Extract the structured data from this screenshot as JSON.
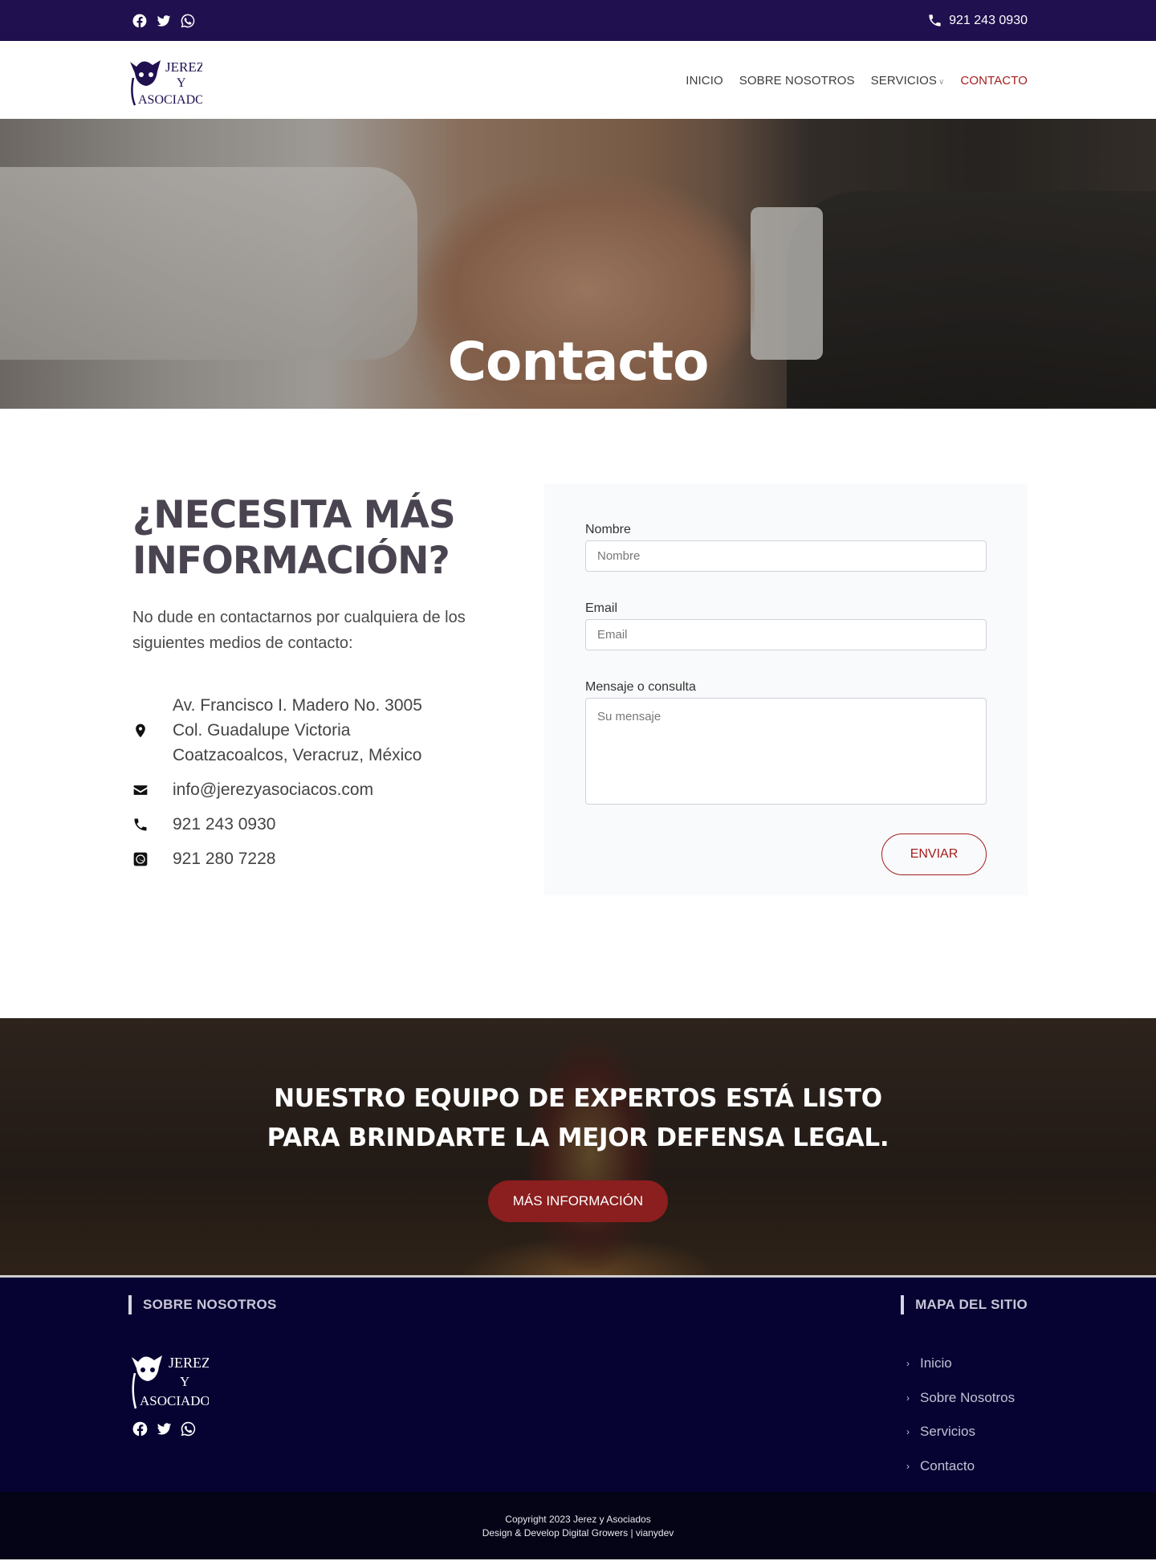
{
  "topbar": {
    "social_icons": [
      "facebook-icon",
      "twitter-icon",
      "whatsapp-icon"
    ],
    "phone": "921 243 0930"
  },
  "brand": {
    "logo_lines": [
      "JEREZ",
      "Y",
      "ASOCIADOS"
    ],
    "primary_color": "#20104f",
    "accent_color": "#a51d1d"
  },
  "nav": {
    "items": [
      {
        "label": "INICIO"
      },
      {
        "label": "SOBRE NOSOTROS"
      },
      {
        "label": "SERVICIOS"
      },
      {
        "label": "CONTACTO",
        "active": true
      }
    ]
  },
  "hero": {
    "title": "Contacto"
  },
  "contact": {
    "heading_line1": "¿NECESITA MÁS",
    "heading_line2": "INFORMACIÓN?",
    "intro": "No dude en contactarnos por cualquiera de los siguientes medios de contacto:",
    "address": [
      "Av. Francisco I. Madero No. 3005",
      "Col. Guadalupe Victoria",
      "Coatzacoalcos, Veracruz, México"
    ],
    "email": "info@jerezyasociacos.com",
    "phone": "921 243 0930",
    "whatsapp": "921 280 7228"
  },
  "form": {
    "name_label": "Nombre",
    "name_placeholder": "Nombre",
    "email_label": "Email",
    "email_placeholder": "Email",
    "message_label": "Mensaje o consulta",
    "message_placeholder": "Su mensaje",
    "submit_label": "ENVIAR"
  },
  "cta": {
    "line1": "NUESTRO EQUIPO DE EXPERTOS ESTÁ LISTO",
    "line2": "PARA BRINDARTE LA MEJOR DEFENSA LEGAL.",
    "button_label": "MÁS INFORMACIÓN"
  },
  "footer": {
    "about_heading": "SOBRE NOSOTROS",
    "sitemap_heading": "MAPA DEL SITIO",
    "sitemap": [
      {
        "label": "Inicio"
      },
      {
        "label": "Sobre Nosotros"
      },
      {
        "label": "Servicios"
      },
      {
        "label": "Contacto"
      }
    ],
    "copyright_line1": "Copyright 2023  Jerez y Asociados",
    "copyright_line2": "Design & Develop Digital Growers | vianydev"
  }
}
